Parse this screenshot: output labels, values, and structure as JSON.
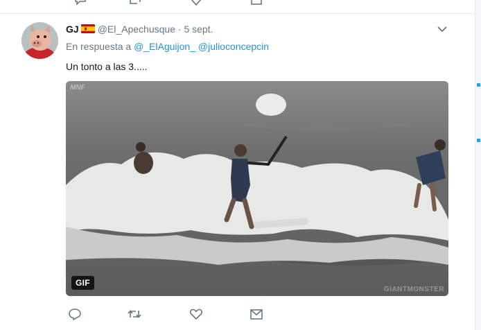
{
  "tweet": {
    "display_name": "GJ",
    "flag_icon": "spain-flag-icon",
    "handle": "@El_Apechusque",
    "separator": "·",
    "time": "5 sept.",
    "reply_prefix": "En respuesta a",
    "reply_mentions": [
      "@_ElAguijon_",
      "@julioconcepcin"
    ],
    "text": "Un tonto a las 3.....",
    "media": {
      "badge": "GIF",
      "corner_text": "MNF",
      "watermark": "GIANTMONSTER"
    },
    "actions": [
      {
        "name": "reply",
        "icon": "reply-icon"
      },
      {
        "name": "retweet",
        "icon": "retweet-icon"
      },
      {
        "name": "like",
        "icon": "heart-icon"
      },
      {
        "name": "message",
        "icon": "envelope-icon"
      }
    ]
  },
  "colors": {
    "link": "#1b95e0",
    "muted": "#657786",
    "text": "#14171a",
    "divider": "#e6ecf0"
  }
}
